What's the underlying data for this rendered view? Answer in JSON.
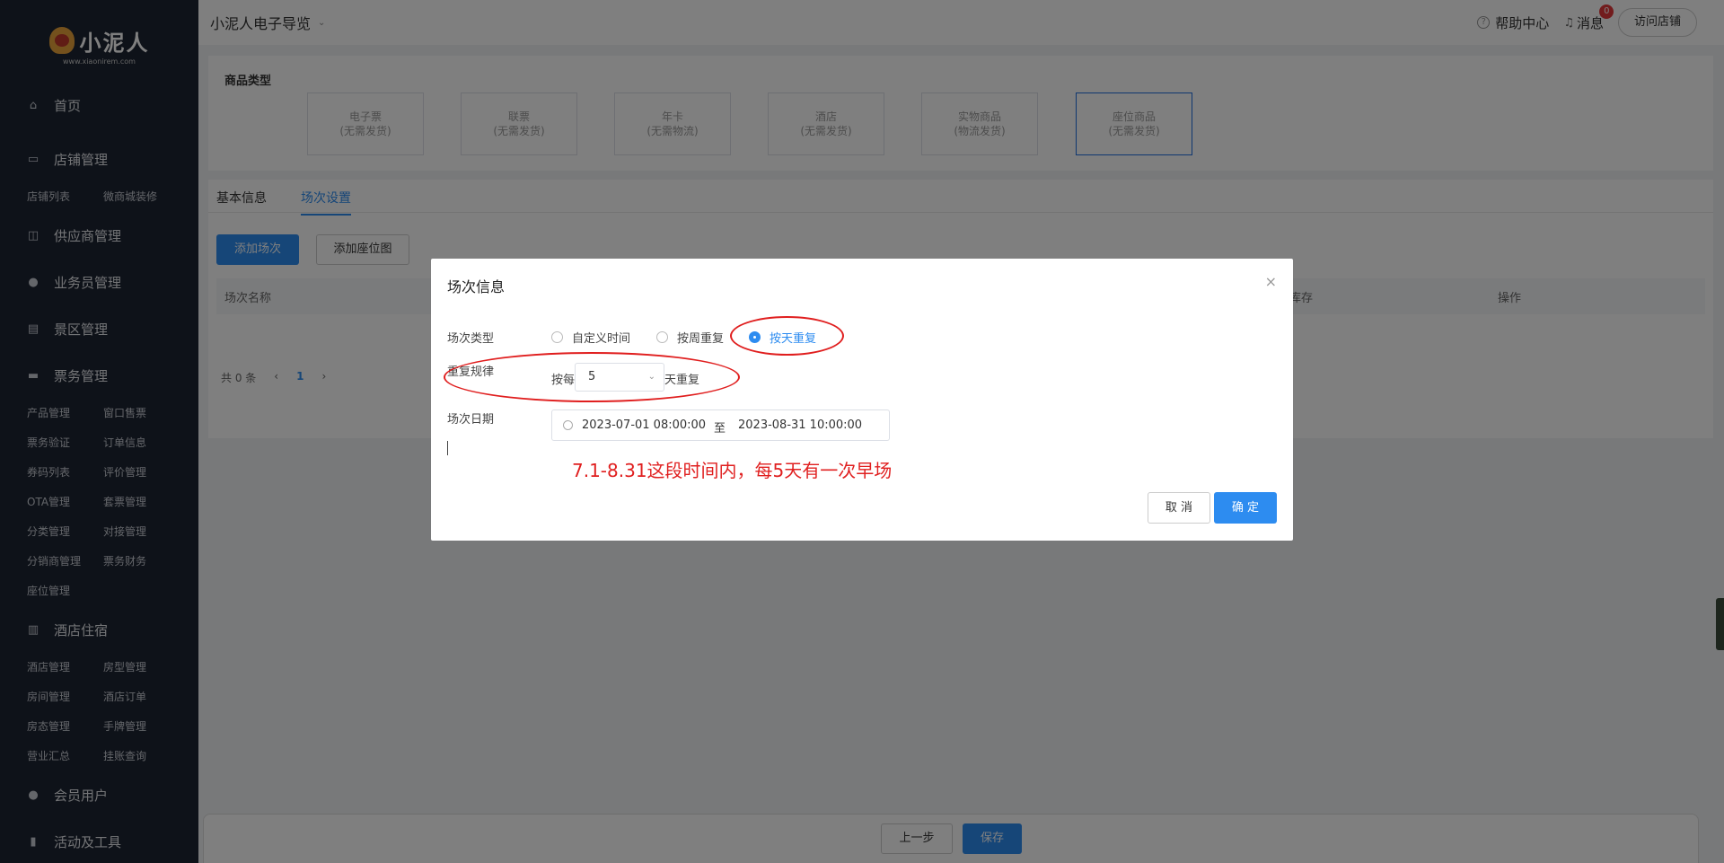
{
  "sidebar": {
    "logo_text": "小泥人",
    "logo_sub": "www.xiaonirem.com",
    "sections": [
      {
        "label": "首页",
        "icon": "home-icon",
        "items": []
      },
      {
        "label": "店铺管理",
        "icon": "store-icon",
        "items": [
          "店铺列表",
          "微商城装修"
        ]
      },
      {
        "label": "供应商管理",
        "icon": "supplier-icon",
        "items": []
      },
      {
        "label": "业务员管理",
        "icon": "user-icon",
        "items": []
      },
      {
        "label": "景区管理",
        "icon": "scenic-icon",
        "items": []
      },
      {
        "label": "票务管理",
        "icon": "ticket-icon",
        "items": [
          "产品管理",
          "窗口售票",
          "票务验证",
          "订单信息",
          "券码列表",
          "评价管理",
          "OTA管理",
          "套票管理",
          "分类管理",
          "对接管理",
          "分销商管理",
          "票务财务",
          "座位管理"
        ]
      },
      {
        "label": "酒店住宿",
        "icon": "hotel-icon",
        "items": [
          "酒店管理",
          "房型管理",
          "房间管理",
          "酒店订单",
          "房态管理",
          "手牌管理",
          "营业汇总",
          "挂账查询"
        ]
      },
      {
        "label": "会员用户",
        "icon": "members-icon",
        "items": []
      },
      {
        "label": "活动及工具",
        "icon": "tools-icon",
        "items": []
      }
    ]
  },
  "header": {
    "title": "小泥人电子导览",
    "help": "帮助中心",
    "messages": "消息",
    "message_count": "0",
    "visit_store": "访问店铺"
  },
  "product_type": {
    "label": "商品类型",
    "options": [
      {
        "name": "电子票",
        "sub": "(无需发货)"
      },
      {
        "name": "联票",
        "sub": "(无需发货)"
      },
      {
        "name": "年卡",
        "sub": "(无需物流)"
      },
      {
        "name": "酒店",
        "sub": "(无需发货)"
      },
      {
        "name": "实物商品",
        "sub": "(物流发货)"
      },
      {
        "name": "座位商品",
        "sub": "(无需发货)"
      }
    ]
  },
  "tabs": [
    "基本信息",
    "场次设置"
  ],
  "actions": {
    "add_session": "添加场次",
    "add_seatmap": "添加座位图"
  },
  "table": {
    "headers": [
      "场次名称",
      "库存",
      "操作"
    ]
  },
  "pager": {
    "total": "共 0 条",
    "prev": "‹",
    "page": "1",
    "next": "›"
  },
  "footer": {
    "prev": "上一步",
    "save": "保存"
  },
  "dialog": {
    "title": "场次信息",
    "close": "×",
    "type_label": "场次类型",
    "types": [
      "自定义时间",
      "按周重复",
      "按天重复"
    ],
    "selected_type": "按天重复",
    "repeat_label": "重复规律",
    "repeat_prefix": "按每",
    "repeat_value": "5",
    "repeat_suffix": "天重复",
    "date_label": "场次日期",
    "date_start": "2023-07-01 08:00:00",
    "date_sep": "至",
    "date_end": "2023-08-31 10:00:00",
    "note": "7.1-8.31这段时间内，每5天有一次早场",
    "cancel": "取 消",
    "ok": "确 定"
  }
}
